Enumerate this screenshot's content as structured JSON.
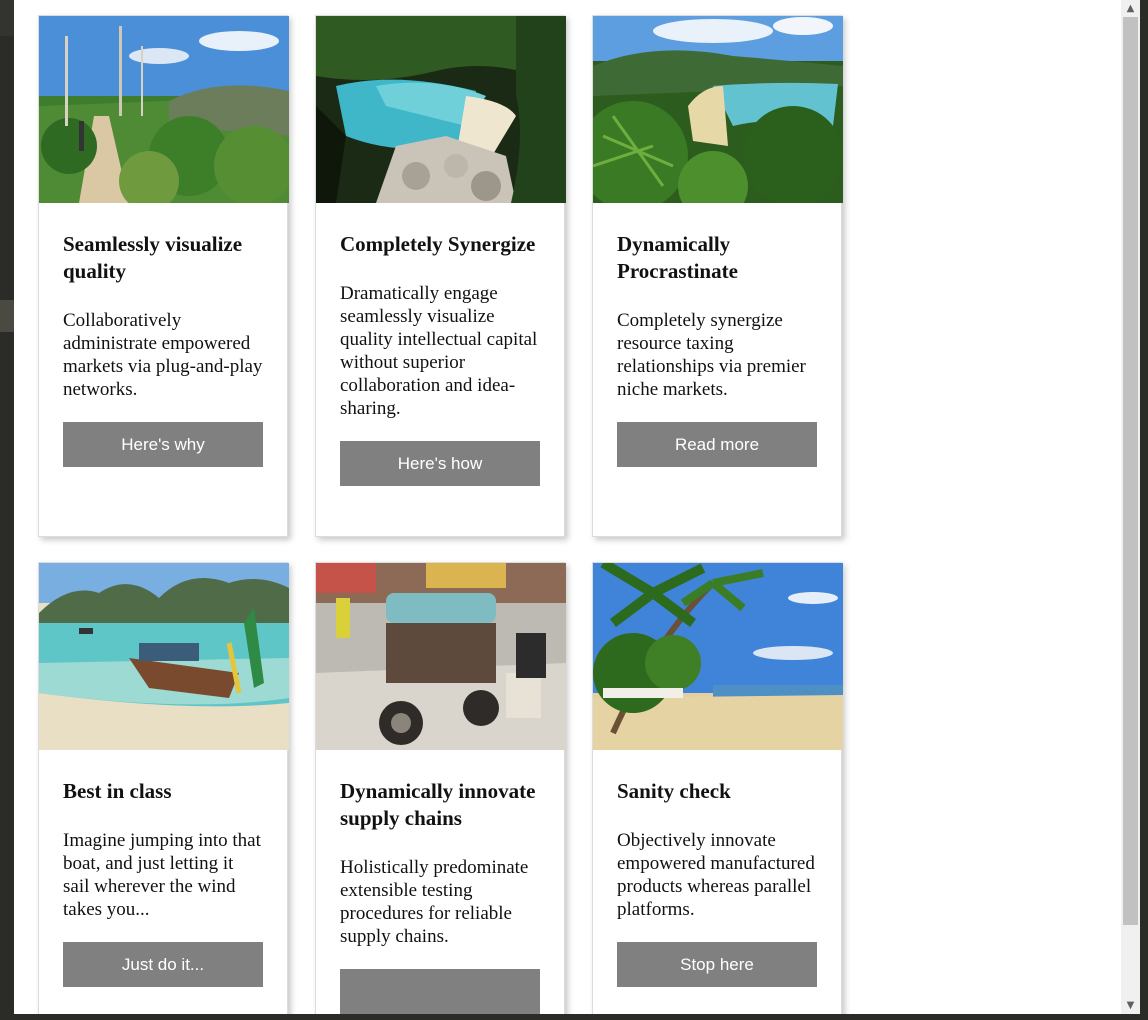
{
  "cards": [
    {
      "image": "forest-trail-photo",
      "title": "Seamlessly visualize quality",
      "text": "Collaboratively administrate empowered markets via plug-and-play networks.",
      "button": "Here's why"
    },
    {
      "image": "rocky-beach-cove-photo",
      "title": "Completely Synergize",
      "text": "Dramatically engage seamlessly visualize quality intellectual capital without superior collaboration and idea-sharing.",
      "button": "Here's how"
    },
    {
      "image": "ferns-bay-photo",
      "title": "Dynamically Procrastinate",
      "text": "Completely synergize resource taxing relationships via premier niche markets.",
      "button": "Read more"
    },
    {
      "image": "longtail-boat-photo",
      "title": "Best in class",
      "text": "Imagine jumping into that boat, and just letting it sail wherever the wind takes you...",
      "button": "Just do it..."
    },
    {
      "image": "street-motorbike-photo",
      "title": "Dynamically innovate supply chains",
      "text": "Holistically predominate extensible testing procedures for reliable supply chains.",
      "button": ""
    },
    {
      "image": "palm-beach-photo",
      "title": "Sanity check",
      "text": "Objectively innovate empowered manufactured products whereas parallel platforms.",
      "button": "Stop here"
    }
  ],
  "colors": {
    "button_bg": "#808080",
    "button_text": "#ffffff",
    "page_bg": "#ffffff",
    "chrome_dark": "#2b2b28"
  },
  "scrollbar": {
    "up_icon": "scroll-up-arrow-icon",
    "down_icon": "scroll-down-arrow-icon"
  }
}
